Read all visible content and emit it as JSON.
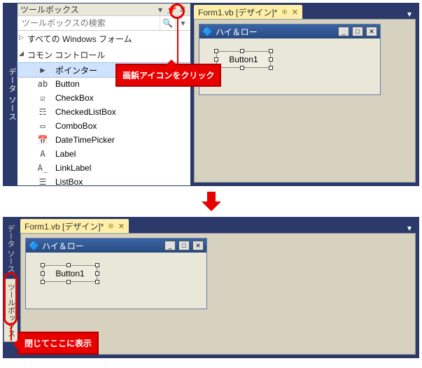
{
  "sideStrip": {
    "label": "データ ソース"
  },
  "toolbox": {
    "title": "ツールボックス",
    "searchPlaceholder": "ツールボックスの検索",
    "categories": [
      {
        "label": "すべての Windows フォーム",
        "open": false
      },
      {
        "label": "コモン コントロール",
        "open": true
      }
    ],
    "items": [
      {
        "icon": "▶",
        "label": "ポインター",
        "selected": true
      },
      {
        "icon": "ab",
        "label": "Button"
      },
      {
        "icon": "☑",
        "label": "CheckBox"
      },
      {
        "icon": "☶",
        "label": "CheckedListBox"
      },
      {
        "icon": "▭",
        "label": "ComboBox"
      },
      {
        "icon": "📅",
        "label": "DateTimePicker"
      },
      {
        "icon": "A",
        "label": "Label"
      },
      {
        "icon": "A̲",
        "label": "LinkLabel"
      },
      {
        "icon": "☰",
        "label": "ListBox"
      }
    ]
  },
  "tab": {
    "label": "Form1.vb [デザイン]*"
  },
  "form": {
    "title": "ハイ＆ロー",
    "buttonText": "Button1"
  },
  "callouts": {
    "pin": "画鋲アイコンをクリック",
    "collapsed": "閉じてここに表示"
  },
  "collapsedTabs": {
    "first": "データ ソース",
    "second": "ツールボックス"
  }
}
